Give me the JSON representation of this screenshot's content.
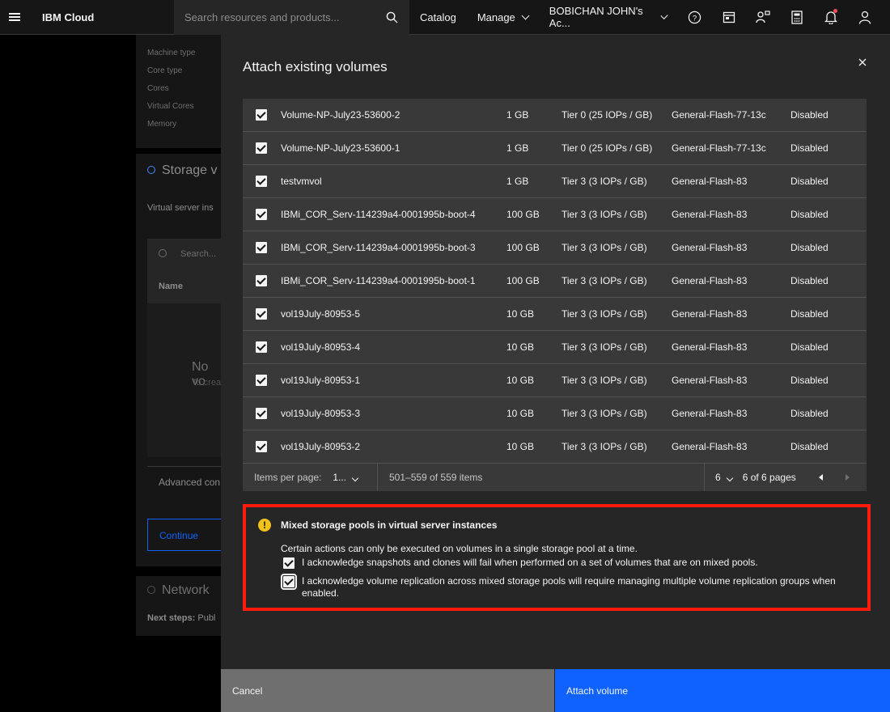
{
  "topbar": {
    "brand": "IBM Cloud",
    "search_placeholder": "Search resources and products...",
    "catalog": "Catalog",
    "manage": "Manage",
    "account": "BOBICHAN JOHN's Ac..."
  },
  "background": {
    "labels": [
      "Machine type",
      "Core type",
      "Cores",
      "Virtual Cores",
      "Memory"
    ],
    "storage_heading": "Storage v",
    "virtual_server": "Virtual server ins",
    "search": "Search...",
    "name_col": "Name",
    "no_vol": "No vo",
    "to_create": "To crea",
    "advanced": "Advanced con",
    "continue": "Continue",
    "network": "Network",
    "next_steps_label": "Next steps:",
    "next_steps_value": "Publ"
  },
  "modal": {
    "title": "Attach existing volumes",
    "rows": [
      {
        "name": "Volume-NP-July23-53600-2",
        "size": "1 GB",
        "tier": "Tier 0 (25 IOPs / GB)",
        "pool": "General-Flash-77-13c",
        "replication": "Disabled"
      },
      {
        "name": "Volume-NP-July23-53600-1",
        "size": "1 GB",
        "tier": "Tier 0 (25 IOPs / GB)",
        "pool": "General-Flash-77-13c",
        "replication": "Disabled"
      },
      {
        "name": "testvmvol",
        "size": "1 GB",
        "tier": "Tier 3 (3 IOPs / GB)",
        "pool": "General-Flash-83",
        "replication": "Disabled"
      },
      {
        "name": "IBMi_COR_Serv-114239a4-0001995b-boot-4",
        "size": "100 GB",
        "tier": "Tier 3 (3 IOPs / GB)",
        "pool": "General-Flash-83",
        "replication": "Disabled"
      },
      {
        "name": "IBMi_COR_Serv-114239a4-0001995b-boot-3",
        "size": "100 GB",
        "tier": "Tier 3 (3 IOPs / GB)",
        "pool": "General-Flash-83",
        "replication": "Disabled"
      },
      {
        "name": "IBMi_COR_Serv-114239a4-0001995b-boot-1",
        "size": "100 GB",
        "tier": "Tier 3 (3 IOPs / GB)",
        "pool": "General-Flash-83",
        "replication": "Disabled"
      },
      {
        "name": "vol19July-80953-5",
        "size": "10 GB",
        "tier": "Tier 3 (3 IOPs / GB)",
        "pool": "General-Flash-83",
        "replication": "Disabled"
      },
      {
        "name": "vol19July-80953-4",
        "size": "10 GB",
        "tier": "Tier 3 (3 IOPs / GB)",
        "pool": "General-Flash-83",
        "replication": "Disabled"
      },
      {
        "name": "vol19July-80953-1",
        "size": "10 GB",
        "tier": "Tier 3 (3 IOPs / GB)",
        "pool": "General-Flash-83",
        "replication": "Disabled"
      },
      {
        "name": "vol19July-80953-3",
        "size": "10 GB",
        "tier": "Tier 3 (3 IOPs / GB)",
        "pool": "General-Flash-83",
        "replication": "Disabled"
      },
      {
        "name": "vol19July-80953-2",
        "size": "10 GB",
        "tier": "Tier 3 (3 IOPs / GB)",
        "pool": "General-Flash-83",
        "replication": "Disabled"
      }
    ],
    "pagination": {
      "items_per_page_label": "Items per page:",
      "items_per_page_value": "1...",
      "range": "501–559 of 559 items",
      "page": "6",
      "of_pages": "6 of 6 pages"
    },
    "warning": {
      "title": "Mixed storage pools in virtual server instances",
      "description": "Certain actions can only be executed on volumes in a single storage pool at a time.",
      "ack1": "I acknowledge snapshots and clones will fail when performed on a set of volumes that are on mixed pools.",
      "ack2": "I acknowledge volume replication across mixed storage pools will require managing multiple volume replication groups when enabled."
    },
    "cancel": "Cancel",
    "attach": "Attach volume"
  },
  "colors": {
    "primary_blue": "#0f62fe",
    "warning_yellow": "#f1c21b",
    "highlight_red": "#ff1a0a",
    "notification_dot": "#fa4d56"
  }
}
